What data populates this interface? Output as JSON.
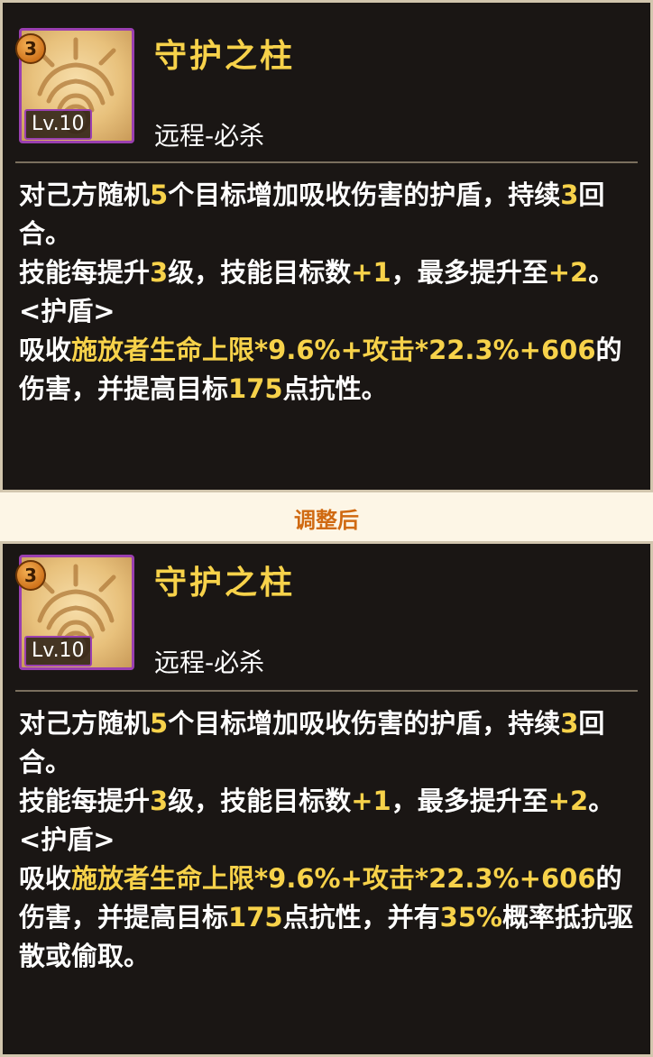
{
  "before": {
    "rank": "3",
    "level": "Lv.10",
    "name": "守护之柱",
    "type": "远程-必杀",
    "line1": [
      "对己方随机",
      "5",
      "个目标增加吸收伤害的护盾，持续",
      "3",
      "回合。"
    ],
    "line2": [
      "技能每提升",
      "3",
      "级，技能目标数",
      "+1",
      "，最多提升至",
      "+2",
      "。"
    ],
    "line3": "<护盾>",
    "line4": [
      "吸收",
      "施放者生命上限*9.6%+攻击*22.3%+606",
      "的伤害，并提高目标",
      "175",
      "点抗性。"
    ]
  },
  "section_label": "调整后",
  "after": {
    "rank": "3",
    "level": "Lv.10",
    "name": "守护之柱",
    "type": "远程-必杀",
    "line1": [
      "对己方随机",
      "5",
      "个目标增加吸收伤害的护盾，持续",
      "3",
      "回合。"
    ],
    "line2": [
      "技能每提升",
      "3",
      "级，技能目标数",
      "+1",
      "，最多提升至",
      "+2",
      "。"
    ],
    "line3": "<护盾>",
    "line4": [
      "吸收",
      "施放者生命上限*9.6%+攻击*22.3%+606",
      "的伤害，并提高目标",
      "175",
      "点抗性，并有",
      "35%",
      "概率抵抗驱散或偷取。"
    ]
  },
  "colors": {
    "highlight": "#f7d24a",
    "text": "#ffffff",
    "panel": "#1a1614",
    "rarity_border": "#9a3fb0",
    "section_label": "#d06a12"
  },
  "icons": [
    "rank-badge-icon",
    "skill-shield-icon"
  ]
}
